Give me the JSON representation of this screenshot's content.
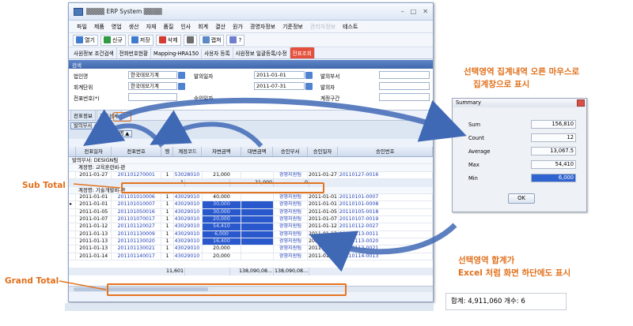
{
  "window": {
    "title": "▒▒▒▒ ERP System ▒▒▒▒"
  },
  "menu": [
    "파일",
    "제품",
    "영업",
    "생산",
    "자재",
    "품질",
    "인사",
    "회계",
    "결산",
    "원가",
    "경영자정보",
    "기준정보",
    "관리자정보",
    "테스트"
  ],
  "toolbar": [
    {
      "label": "열기",
      "color": "#3e7bd1"
    },
    {
      "label": "신규",
      "color": "#2f9b45"
    },
    {
      "label": "저장",
      "color": "#3e7bd1"
    },
    {
      "label": "삭제",
      "color": "#d33b32"
    },
    {
      "label": "",
      "color": "#6d6d6d"
    },
    {
      "label": "캡쳐",
      "color": "#5a88c8"
    },
    {
      "label": "?",
      "color": "#6f7fd0"
    }
  ],
  "tabs": [
    "사원정보 조건검색",
    "전화번호현황",
    "Mapping-HRA150",
    "사용자 등록",
    "사원정보 일괄등록/수정",
    "전표조회"
  ],
  "search": {
    "header": "검색",
    "labels": {
      "bizunit": "법인명",
      "acctunit": "회계단위",
      "voucherno": "전표번호(*)",
      "fromdate": "발의일자",
      "todate": "승인일자",
      "dept": "발의부서",
      "issuer": "발의자",
      "acctrange": "계정구간"
    },
    "values": {
      "bizunit": "한국데모기계",
      "acctunit": "한국데모기계",
      "fromdate": "2011-01-01",
      "todate": "2011-07-31"
    }
  },
  "subtabs": [
    "전표정보",
    "전표상세"
  ],
  "groups": {
    "g1": "발의부서",
    "g2": "계정명"
  },
  "columns": [
    "",
    "전표일자",
    "전표번호",
    "행",
    "계정코드",
    "차변금액",
    "대변금액",
    "승인부서",
    "승인일자",
    "승인번호"
  ],
  "group1": "발의부서: DESIGN팀",
  "group2a": "계정명: 교육훈련비-판",
  "rowsA": [
    [
      "2011-01-27",
      "201101270001",
      "1",
      "53028010",
      "21,000",
      "",
      "경영지원팀",
      "2011-01-27",
      "20110127-0016"
    ]
  ],
  "subtotal": [
    "1",
    "21,000",
    "0"
  ],
  "group2b": "계정명: 기술개발비-판",
  "rowsB": [
    [
      "2011-01-01",
      "201101010006",
      "1",
      "43029010",
      "40,000",
      "",
      "경영지원팀",
      "2011-01-01",
      "20110101-0007"
    ],
    [
      "2011-01-01",
      "201101010007",
      "1",
      "43029010",
      "30,000",
      "",
      "경영지원팀",
      "2011-01-01",
      "20110101-0008"
    ],
    [
      "2011-01-05",
      "201101050016",
      "1",
      "43029010",
      "30,000",
      "",
      "경영지원팀",
      "2011-01-05",
      "20110105-0018"
    ],
    [
      "2011-01-07",
      "201101070017",
      "1",
      "43029010",
      "20,000",
      "",
      "경영지원팀",
      "2011-01-07",
      "20110107-0019"
    ],
    [
      "2011-01-12",
      "201101120027",
      "1",
      "43029010",
      "54,410",
      "",
      "경영지원팀",
      "2011-01-12",
      "20110112-0027"
    ],
    [
      "2011-01-13",
      "201101130009",
      "1",
      "43029010",
      "6,000",
      "",
      "경영지원팀",
      "2011-01-13",
      "20110113-0011"
    ],
    [
      "2011-01-13",
      "201101130020",
      "1",
      "43029010",
      "16,400",
      "",
      "경영지원팀",
      "2011-01-13",
      "20110113-0020"
    ],
    [
      "2011-01-13",
      "201101130021",
      "1",
      "43029010",
      "20,000",
      "",
      "경영지원팀",
      "2011-01-13",
      "20110113-0021"
    ],
    [
      "2011-01-14",
      "201101140017",
      "1",
      "43029010",
      "20,000",
      "",
      "경영지원팀",
      "2011-01-14",
      "20110114-0013"
    ]
  ],
  "grandtotal": [
    "11,601",
    "138,090,08...",
    "138,090,08..."
  ],
  "summary": {
    "title": "Summary",
    "rows": [
      {
        "label": "Sum",
        "value": "156,810"
      },
      {
        "label": "Count",
        "value": "12"
      },
      {
        "label": "Average",
        "value": "13,067.5"
      },
      {
        "label": "Max",
        "value": "54,410"
      },
      {
        "label": "Min",
        "value": "6,000"
      }
    ],
    "ok": "OK"
  },
  "excel_status": "합계: 4,911,060   개수: 6",
  "annotations": {
    "top_line1": "선택영역 집계내역 오른 마우스로",
    "top_line2": "집계창으로 표시",
    "bottom_line1": "선택영역 합계가",
    "bottom_line2": "Excel 처럼 화면 하단에도 표시",
    "subtotal": "Sub Total",
    "grandtotal": "Grand Total"
  },
  "colors": {
    "accent": "#e37420",
    "selected": "#2958cc",
    "active_tab": "#e4503b"
  }
}
